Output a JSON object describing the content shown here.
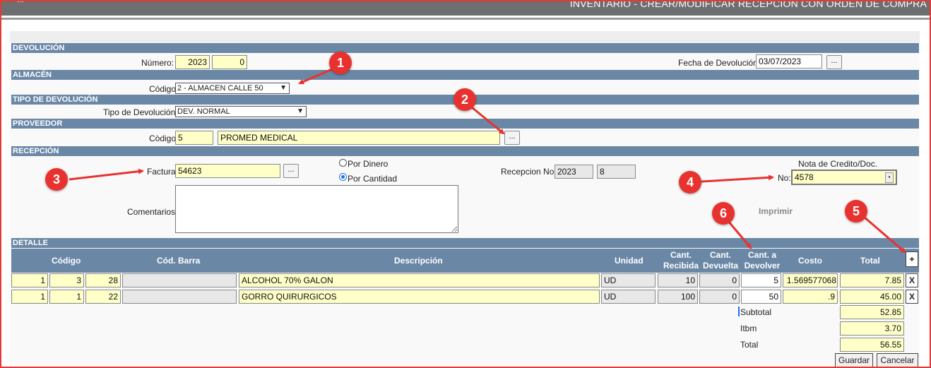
{
  "header": {
    "left_text": "...",
    "title": "INVENTARIO - CREAR/MODIFICAR RECEPCION CON ORDEN DE COMPRA"
  },
  "devolucion": {
    "section": "DEVOLUCIÓN",
    "numero_label": "Número:",
    "numero_year": "2023",
    "numero_seq": "0",
    "fecha_label": "Fecha de Devolución",
    "fecha_value": "03/07/2023",
    "fecha_button": "..."
  },
  "almacen": {
    "section": "ALMACÉN",
    "codigo_label": "Código",
    "codigo_selected": "2 - ALMACEN CALLE 50"
  },
  "tipo": {
    "section": "TIPO DE DEVOLUCIÓN",
    "label": "Tipo de Devolución",
    "selected": "DEV. NORMAL"
  },
  "proveedor": {
    "section": "PROVEEDOR",
    "codigo_label": "Còdigo",
    "codigo_value": "5",
    "nombre_value": "PROMED MEDICAL",
    "lookup_button": "..."
  },
  "recepcion": {
    "section": "RECEPCIÓN",
    "factura_label": "Factura",
    "factura_value": "54623",
    "factura_button": "...",
    "radio_dinero": "Por Dinero",
    "radio_cantidad": "Por Cantidad",
    "recepcion_label": "Recepcion No",
    "recepcion_year": "2023",
    "recepcion_seq": "8",
    "nota_label": "Nota de Credito/Doc.",
    "no_label": "No:",
    "no_value": "4578",
    "comentarios_label": "Comentarios",
    "comentarios_value": "",
    "imprimir": "Imprimir"
  },
  "detalle": {
    "section": "DETALLE",
    "headers": {
      "codigo": "Código",
      "cod_barra": "Cód. Barra",
      "descripcion": "Descripción",
      "unidad": "Unidad",
      "cant_recibida_1": "Cant.",
      "cant_recibida_2": "Recibida",
      "cant_devuelta_1": "Cant.",
      "cant_devuelta_2": "Devuelta",
      "cant_devolver_1": "Cant. a",
      "cant_devolver_2": "Devolver",
      "costo": "Costo",
      "total": "Total"
    },
    "add_button": "+",
    "remove_button": "X",
    "rows": [
      {
        "c1": "1",
        "c2": "3",
        "c3": "28",
        "barra": "",
        "descripcion": "ALCOHOL 70% GALON",
        "unidad": "UD",
        "recibida": "10",
        "devuelta": "0",
        "devolver": "5",
        "costo": "1.569577068",
        "total": "7.85"
      },
      {
        "c1": "1",
        "c2": "1",
        "c3": "22",
        "barra": "",
        "descripcion": "GORRO QUIRURGICOS",
        "unidad": "UD",
        "recibida": "100",
        "devuelta": "0",
        "devolver": "50",
        "costo": ".9",
        "total": "45.00"
      }
    ]
  },
  "totals": {
    "subtotal_label": "Subtotal",
    "subtotal": "52.85",
    "itbm_label": "Itbm",
    "itbm": "3.70",
    "total_label": "Total",
    "total": "56.55"
  },
  "buttons": {
    "guardar": "Guardar",
    "cancelar": "Cancelar"
  },
  "callouts": [
    "1",
    "2",
    "3",
    "4",
    "5",
    "6"
  ],
  "colors": {
    "section_bg": "#6a87a6",
    "field_bg": "#ffffc8",
    "callout": "#e8322f",
    "frame": "#e53935"
  }
}
